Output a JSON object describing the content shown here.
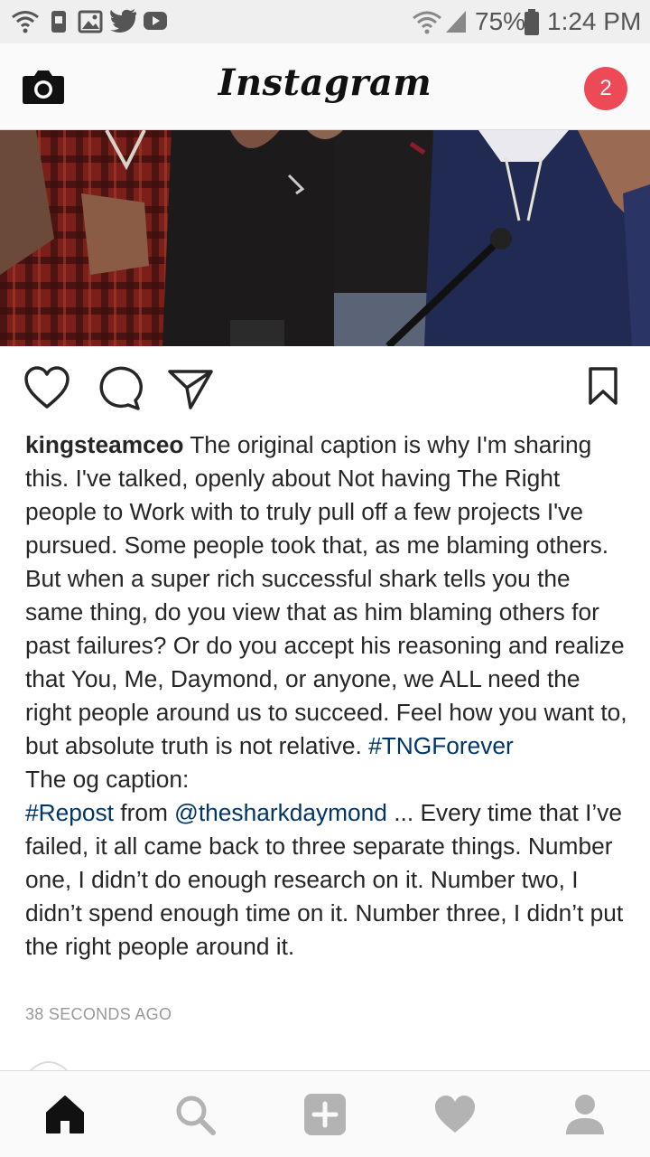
{
  "status_bar": {
    "battery": "75%",
    "time": "1:24 PM",
    "left_icons": [
      "wifi-icon",
      "nfc-icon",
      "gallery-icon",
      "twitter-icon",
      "youtube-icon"
    ],
    "right_icons": [
      "wifi-signal-icon",
      "cell-signal-icon",
      "battery-icon"
    ]
  },
  "header": {
    "logo": "Instagram",
    "notification_count": "2",
    "badge_color": "#ed4956"
  },
  "post": {
    "username": "kingsteamceo",
    "caption_part1": " The original caption is why I'm sharing this.  I've talked, openly about Not having The Right people to Work with to truly pull off a few projects I've pursued.  Some people took that, as me blaming others.  But when a super rich successful shark tells you the same thing, do you view that as him blaming others for past failures? Or do you accept his reasoning and realize that You, Me, Daymond, or anyone, we ALL need the right people around us to succeed.  Feel how you want to, but absolute truth is not relative.  ",
    "hashtag1": "#TNGForever",
    "caption_line2": "The og caption:",
    "hashtag2": "#Repost",
    "from_text": " from ",
    "mention": "@thesharkdaymond",
    "caption_part3": " ... Every time that I’ve failed, it all came back to three separate things. Number one, I didn’t do enough research on it. Number two, I didn’t spend enough time on it. Number three, I didn’t put the right people around it.",
    "timestamp": "38 SECONDS AGO",
    "link_color": "#003569"
  },
  "bottom_nav": {
    "items": [
      "home-icon",
      "search-icon",
      "add-post-icon",
      "activity-heart-icon",
      "profile-icon"
    ]
  }
}
